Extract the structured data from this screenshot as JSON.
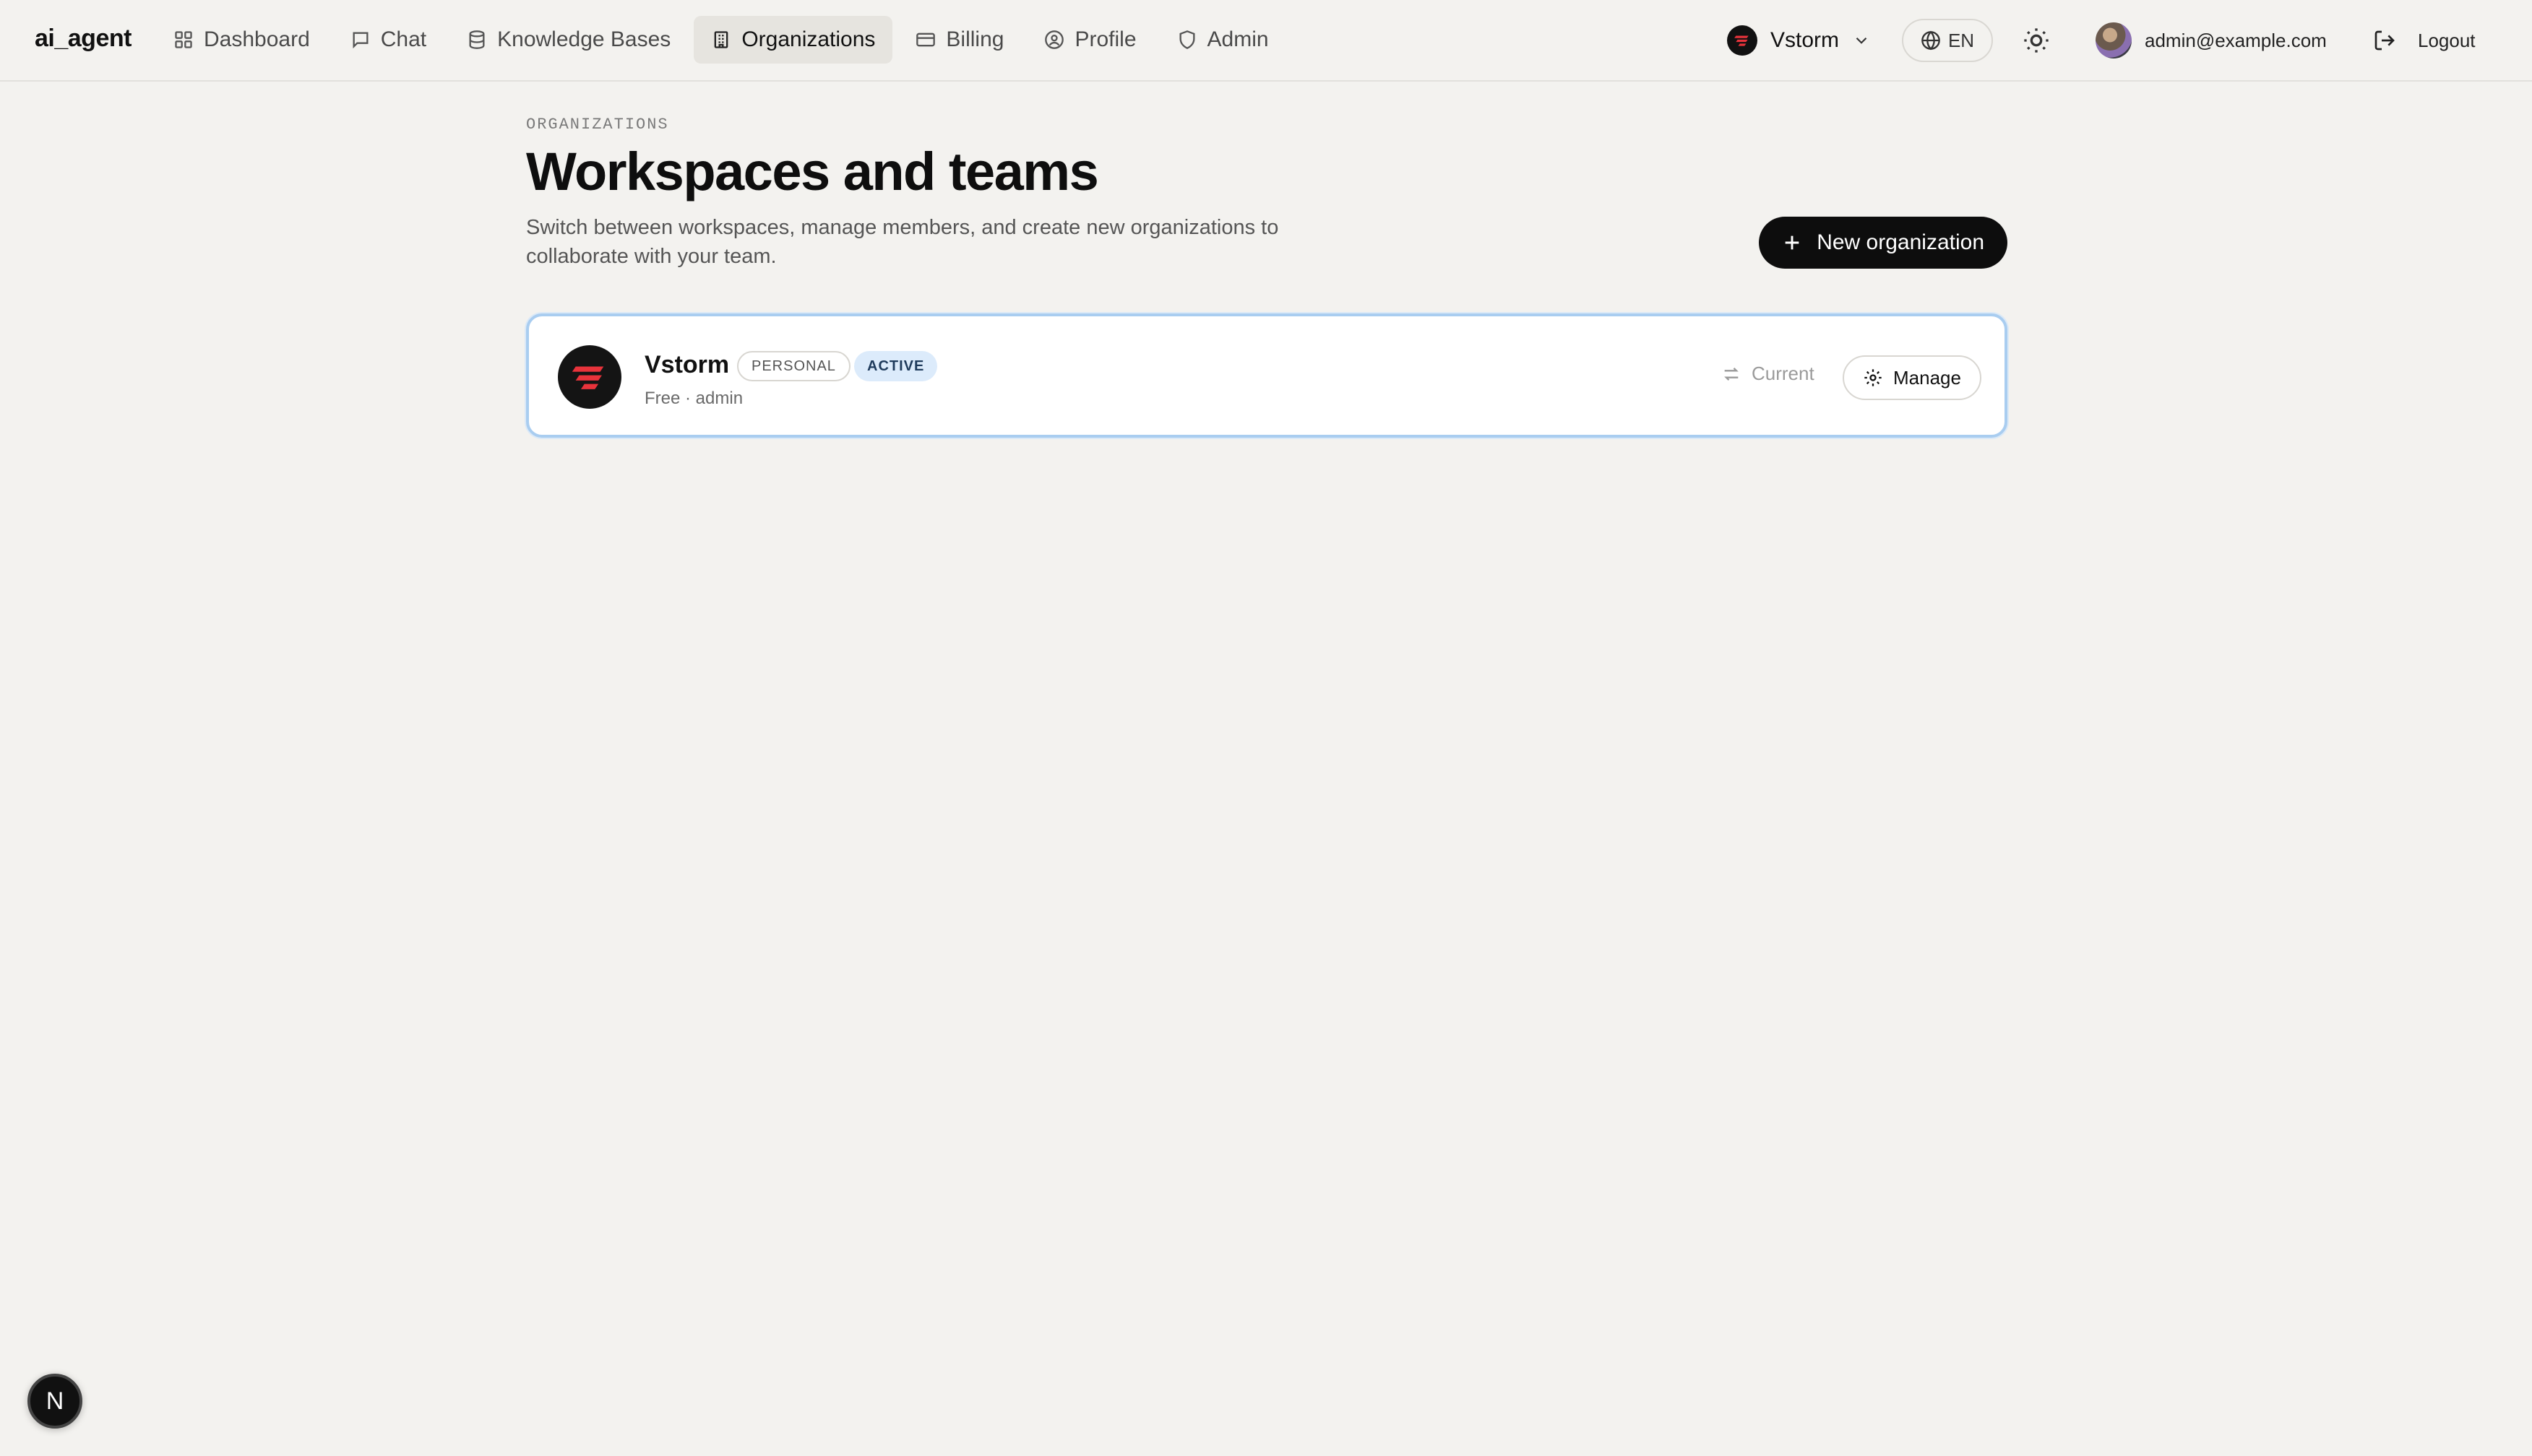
{
  "brand": "ai_agent",
  "nav": {
    "items": [
      {
        "label": "Dashboard",
        "icon": "dashboard-grid-icon"
      },
      {
        "label": "Chat",
        "icon": "chat-bubble-icon"
      },
      {
        "label": "Knowledge Bases",
        "icon": "database-icon"
      },
      {
        "label": "Organizations",
        "icon": "building-icon",
        "active": true
      },
      {
        "label": "Billing",
        "icon": "credit-card-icon"
      },
      {
        "label": "Profile",
        "icon": "user-circle-icon"
      },
      {
        "label": "Admin",
        "icon": "shield-icon"
      }
    ]
  },
  "header": {
    "org_switcher": {
      "label": "Vstorm",
      "icon": "chevron-down-icon"
    },
    "language": "EN",
    "theme_icon": "sun-icon",
    "user_email": "admin@example.com",
    "logout_label": "Logout"
  },
  "page": {
    "eyebrow": "ORGANIZATIONS",
    "title": "Workspaces and teams",
    "subtitle": "Switch between workspaces, manage members, and create new organizations to collaborate with your team.",
    "new_org_label": "New organization"
  },
  "organizations": [
    {
      "name": "Vstorm",
      "badge_type": "PERSONAL",
      "badge_status": "ACTIVE",
      "meta": "Free · admin",
      "current_label": "Current",
      "manage_label": "Manage"
    }
  ],
  "dev_indicator": "N",
  "colors": {
    "background": "#f3f2ef",
    "primary_button": "#0d0d0d",
    "brand_red": "#e8333b",
    "active_badge_bg": "#dcebfb",
    "card_border": "#a9cdf0"
  }
}
